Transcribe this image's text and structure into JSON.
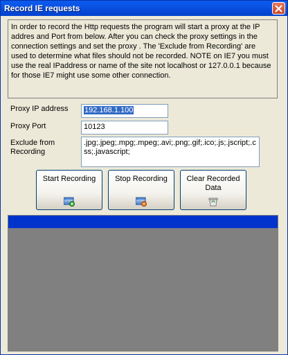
{
  "window": {
    "title": "Record IE requests"
  },
  "info": {
    "text": "In order to record the Http requests the program will start a proxy at the IP addres and Port from below. After you can check the proxy settings in the connection settings and set the proxy . The 'Exclude from Recording' are used to determine what files should not be recorded.  NOTE on IE7 you must use the real IPaddress or name of the site not localhost or 127.0.0.1 because for those IE7 might use some other connection."
  },
  "form": {
    "ip_label": "Proxy IP address",
    "ip_value": "192.168.1.100",
    "port_label": "Proxy Port",
    "port_value": "10123",
    "exclude_label_1": "Exclude from",
    "exclude_label_2": "Recording",
    "exclude_value": ".jpg;.jpeg;.mpg;.mpeg;.avi;.png;.gif;.ico;.js;.jscript;.css;.javascript;"
  },
  "buttons": {
    "start": "Start Recording",
    "stop": "Stop Recording",
    "clear_1": "Clear Recorded",
    "clear_2": "Data"
  },
  "icons": {
    "start": "html-add-icon",
    "stop": "html-stop-icon",
    "clear": "recycle-bin-icon",
    "close": "close-icon"
  },
  "colors": {
    "titlebar": "#0548d6",
    "list_header": "#0033cc",
    "list_body": "#808080",
    "selection": "#316ac5"
  }
}
